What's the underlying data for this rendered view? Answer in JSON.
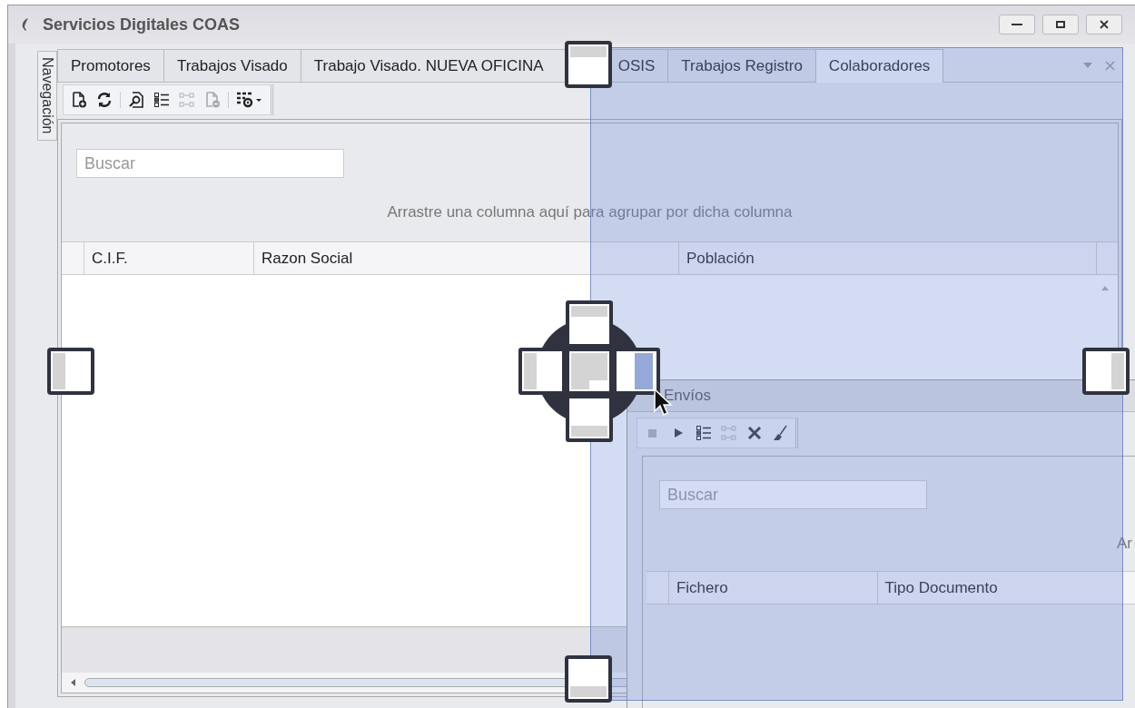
{
  "window": {
    "title": "Servicios Digitales COAS"
  },
  "navigation_tab": {
    "label": "Navegación"
  },
  "tabs": [
    {
      "label": "Promotores",
      "selected": false
    },
    {
      "label": "Trabajos Visado",
      "selected": false
    },
    {
      "label": "Trabajo Visado. NUEVA OFICINA",
      "label_end": "OSIS",
      "selected": false
    },
    {
      "label": "Trabajos Registro",
      "selected": false
    },
    {
      "label": "Colaboradores",
      "selected": true
    }
  ],
  "toolbar": [
    [
      {
        "kind": "new-document",
        "disabled": false
      },
      {
        "kind": "refresh",
        "disabled": false
      }
    ],
    [
      {
        "kind": "find-document",
        "disabled": false
      },
      {
        "kind": "checklist",
        "disabled": false
      },
      {
        "kind": "transfer",
        "disabled": true
      },
      {
        "kind": "remove-document",
        "disabled": true
      }
    ],
    [
      {
        "kind": "grid-settings",
        "disabled": false
      }
    ]
  ],
  "search": {
    "placeholder": "Buscar"
  },
  "group_hint": "Arrastre una columna aquí para agrupar por dicha columna",
  "table": {
    "columns": [
      "C.I.F.",
      "Razon Social",
      "Población"
    ]
  },
  "envios_panel": {
    "title": "Envíos",
    "toolbar": [
      [
        {
          "kind": "stop",
          "disabled": true
        },
        {
          "kind": "play",
          "disabled": false
        },
        {
          "kind": "checklist",
          "disabled": false
        },
        {
          "kind": "transfer",
          "disabled": true
        },
        {
          "kind": "delete",
          "disabled": false
        },
        {
          "kind": "broom",
          "disabled": false
        }
      ]
    ],
    "search": {
      "placeholder": "Buscar"
    },
    "group_hint": "Ar",
    "table": {
      "columns": [
        "Fichero",
        "Tipo Documento"
      ]
    }
  }
}
